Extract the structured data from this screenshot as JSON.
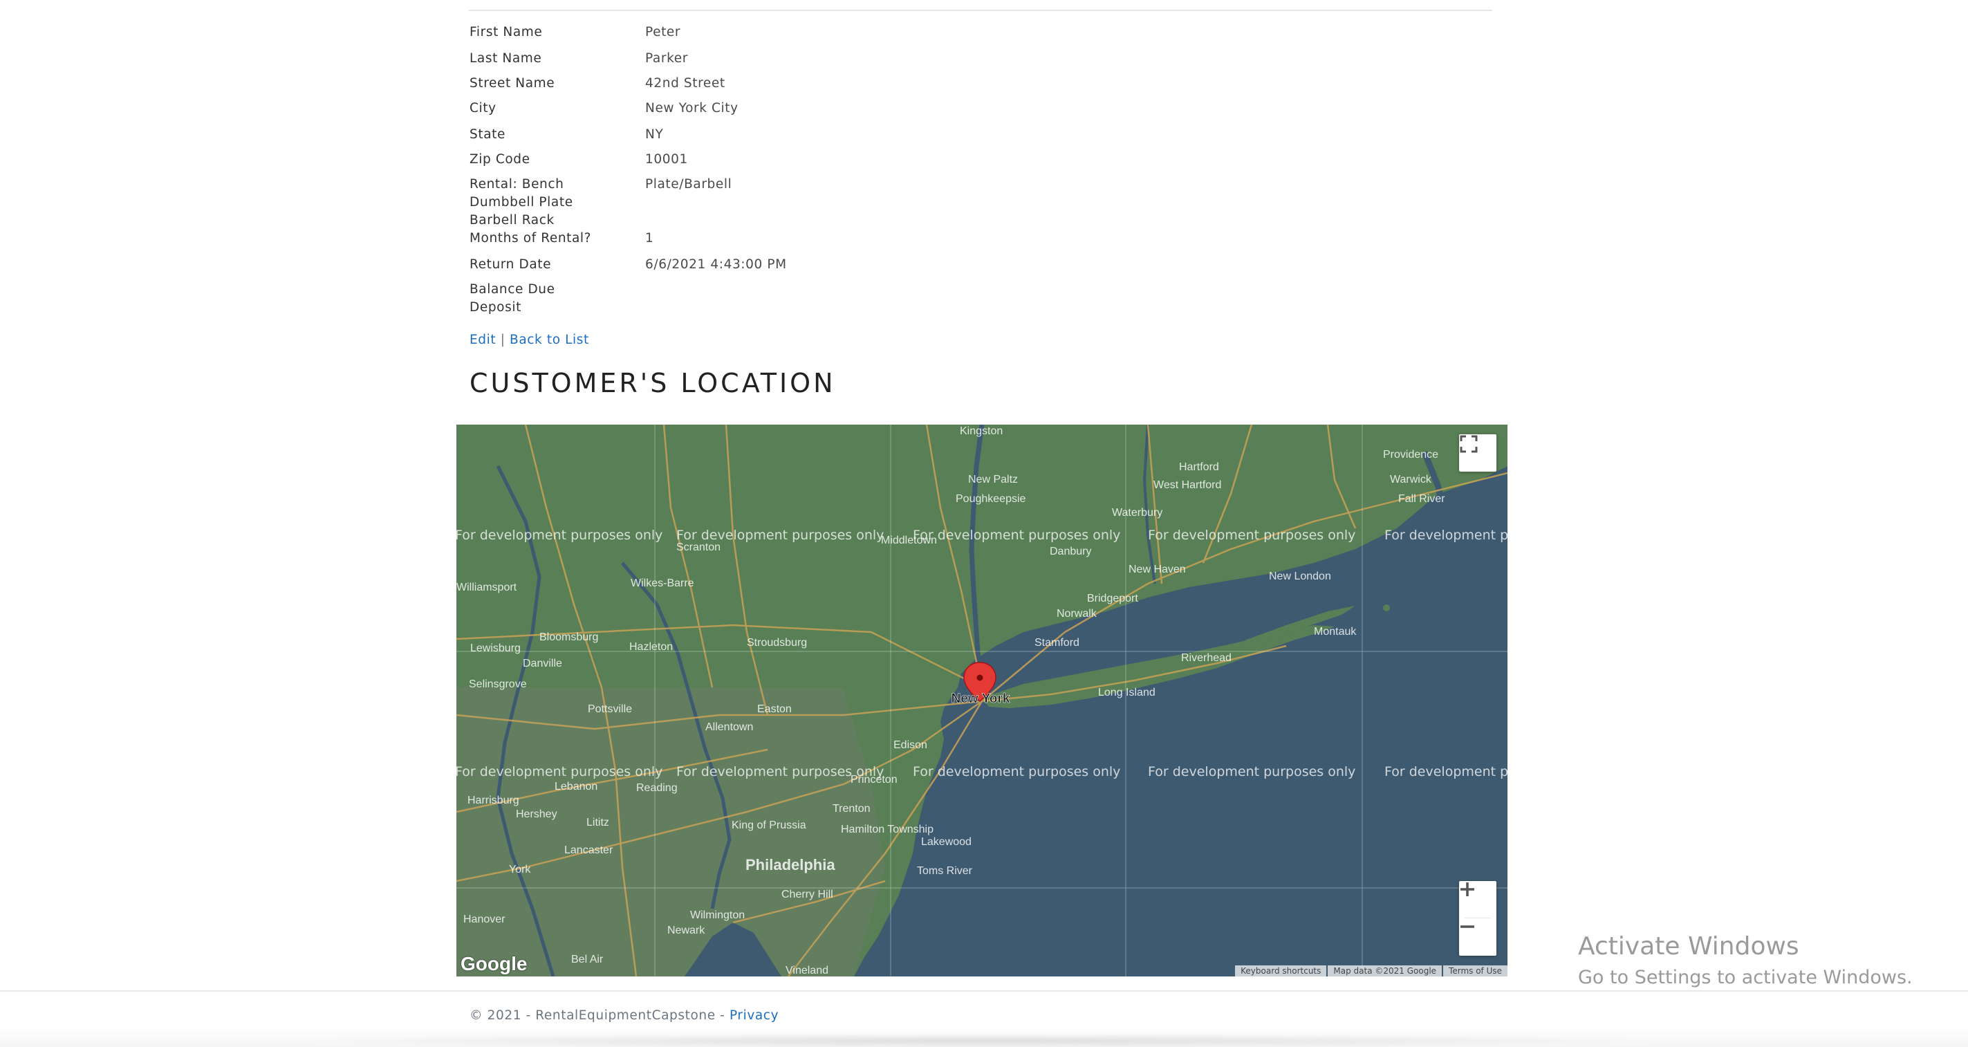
{
  "details": {
    "rows": [
      {
        "label": "First Name",
        "value": "Peter"
      },
      {
        "label": "Last Name",
        "value": "Parker"
      },
      {
        "label": "Street Name",
        "value": "42nd Street"
      },
      {
        "label": "City",
        "value": "New York City"
      },
      {
        "label": "State",
        "value": "NY"
      },
      {
        "label": "Zip Code",
        "value": "10001"
      },
      {
        "label": "Rental: Bench",
        "value": "Plate/Barbell"
      },
      {
        "label": "Dumbbell Plate",
        "value": ""
      },
      {
        "label": "Barbell Rack",
        "value": ""
      },
      {
        "label": "Months of Rental?",
        "value": "1"
      },
      {
        "label": "Return Date",
        "value": "6/6/2021 4:43:00 PM"
      },
      {
        "label": "Balance Due",
        "value": ""
      },
      {
        "label": "Deposit",
        "value": ""
      }
    ]
  },
  "actions": {
    "edit_label": "Edit",
    "separator": "|",
    "back_label": "Back to List"
  },
  "section": {
    "title": "CUSTOMER'S LOCATION"
  },
  "map": {
    "marker_label": "New York",
    "watermark": "For development purposes only",
    "places": [
      "Kingston",
      "Providence",
      "Warwick",
      "Fall River",
      "Hartford",
      "West Hartford",
      "New Paltz",
      "Poughkeepsie",
      "Waterbury",
      "Scranton",
      "Middletown",
      "Danbury",
      "New Haven",
      "New London",
      "Wilkes-Barre",
      "Bridgeport",
      "Norwalk",
      "Stamford",
      "Williamsport",
      "Bloomsburg",
      "Hazleton",
      "Stroudsburg",
      "Lewisburg",
      "Selinsgrove",
      "Danville",
      "Pottsville",
      "Allentown",
      "Easton",
      "Edison",
      "Long Island",
      "Riverhead",
      "Montauk",
      "Reading",
      "Lebanon",
      "Princeton",
      "Trenton",
      "Hamilton Township",
      "Harrisburg",
      "Hershey",
      "Lititz",
      "Lancaster",
      "King of Prussia",
      "Lakewood",
      "Philadelphia",
      "Cherry Hill",
      "Toms River",
      "York",
      "Hanover",
      "Wilmington",
      "Newark",
      "Bel Air",
      "Vineland"
    ],
    "google_logo": "Google",
    "footer": {
      "shortcuts": "Keyboard shortcuts",
      "map_data": "Map data ©2021 Google",
      "terms": "Terms of Use"
    },
    "colors": {
      "land": "#5a7f56",
      "water": "#3e5a70",
      "marker": "#e53935"
    }
  },
  "overlay": {
    "activate_title": "Activate Windows",
    "activate_subtitle": "Go to Settings to activate Windows."
  },
  "footer": {
    "copyright": "© 2021 - RentalEquipmentCapstone -",
    "privacy_label": "Privacy"
  }
}
